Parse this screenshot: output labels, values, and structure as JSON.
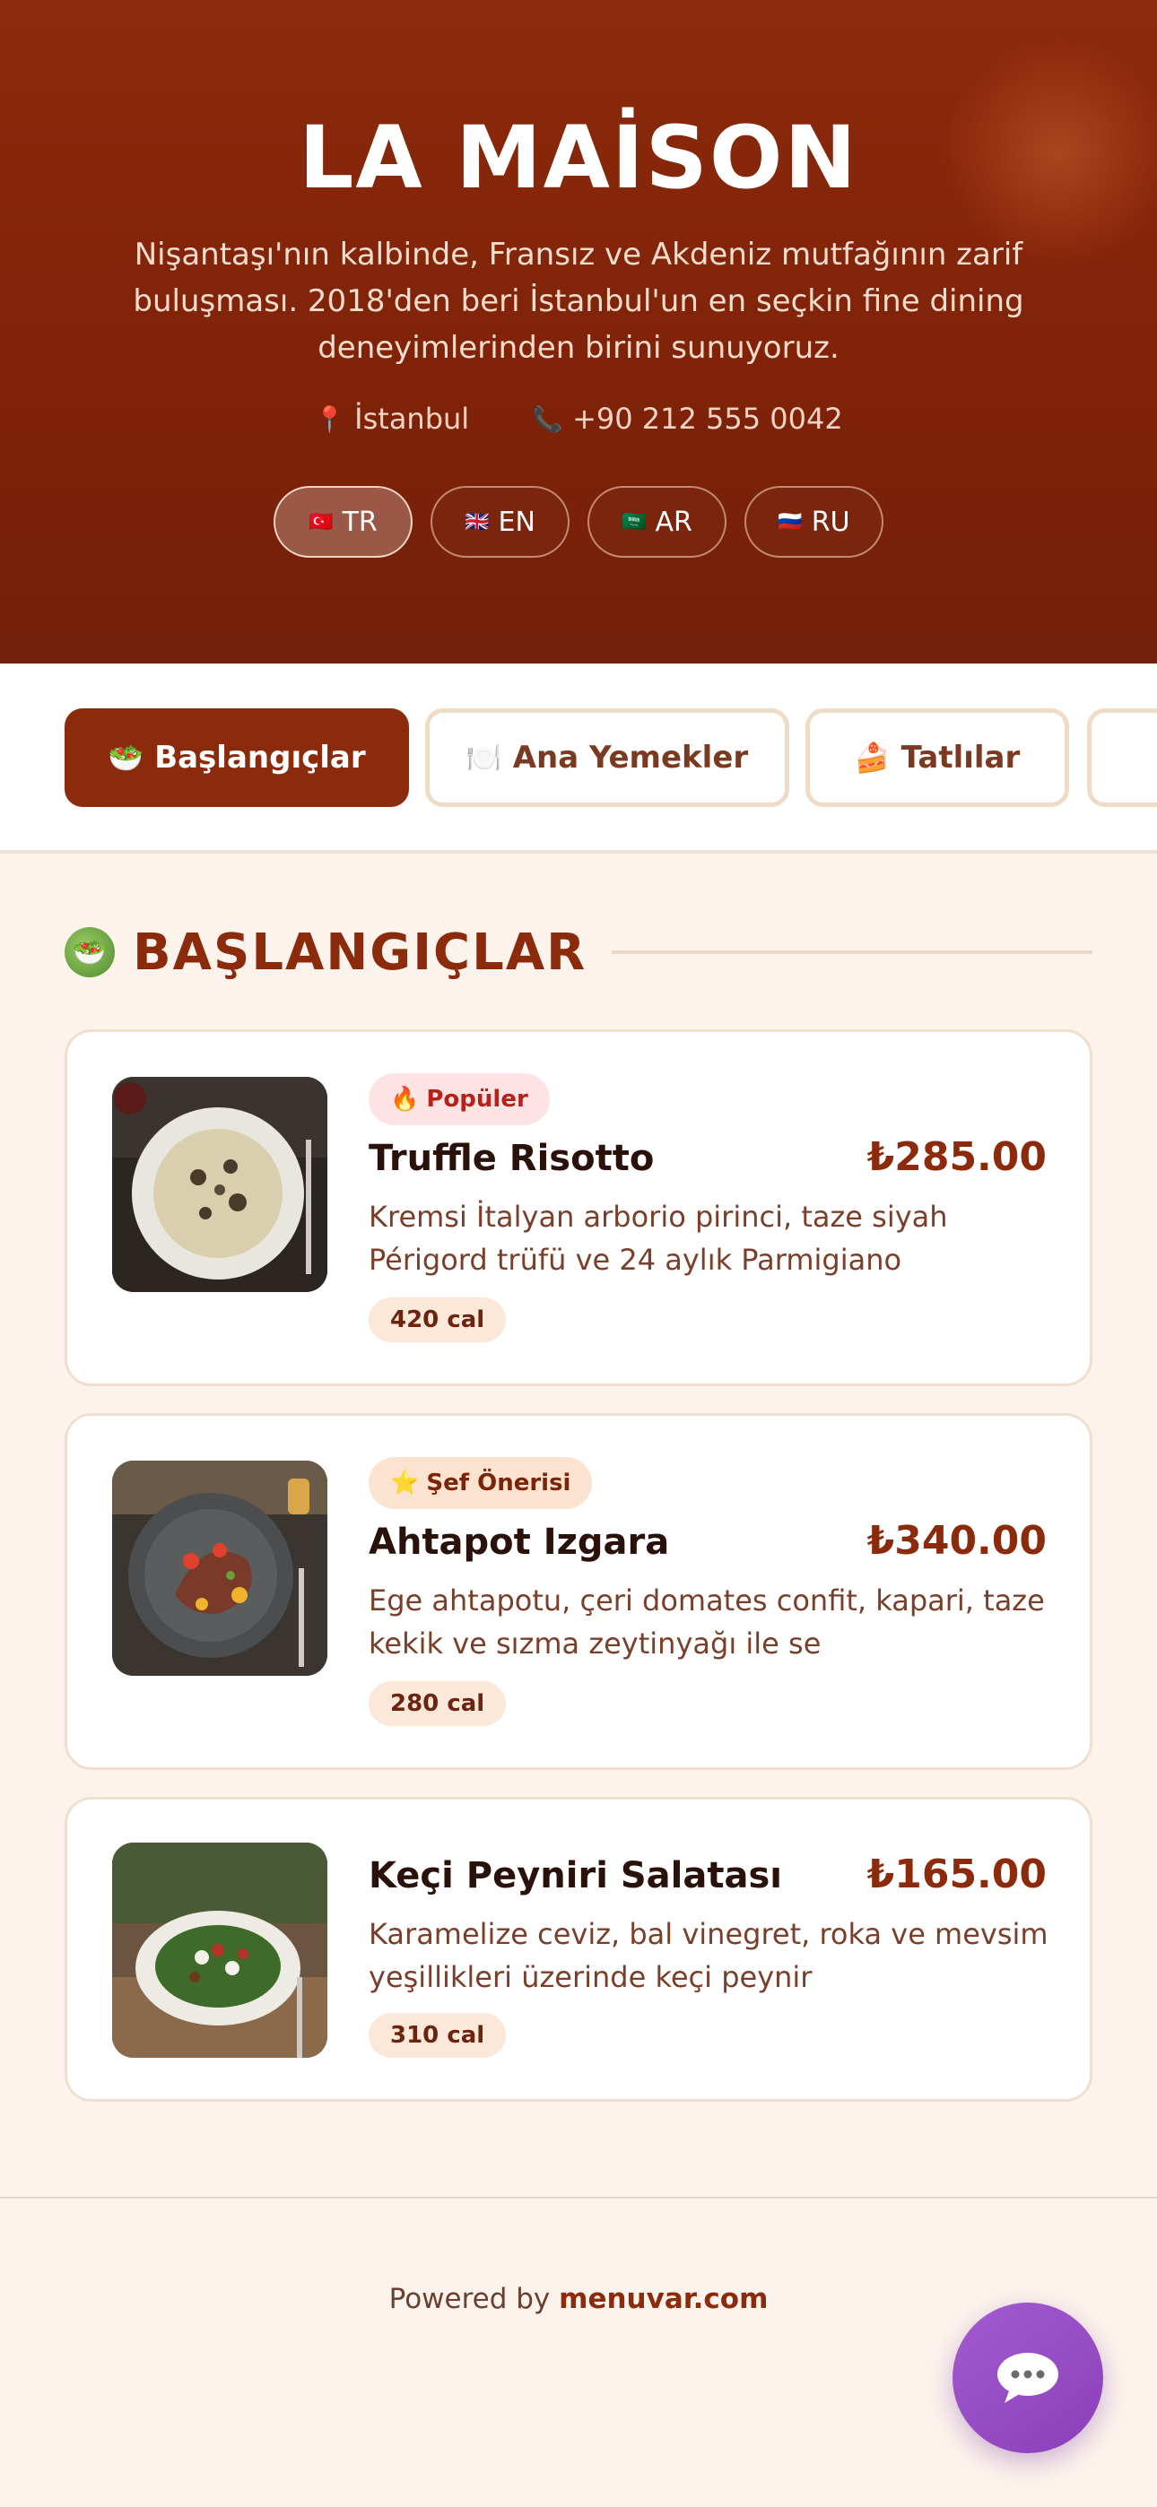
{
  "hero": {
    "title": "LA MAİSON",
    "description": "Nişantaşı'nın kalbinde, Fransız ve Akdeniz mutfağının zarif buluşması. 2018'den beri İstanbul'un en seçkin fine dining deneyimlerinden birini sunuyoruz.",
    "location": "İstanbul",
    "phone": "+90 212 555 0042",
    "location_icon": "pin-icon",
    "phone_icon": "phone-icon"
  },
  "languages": [
    {
      "code": "TR",
      "flag": "tr-flag",
      "active": true
    },
    {
      "code": "EN",
      "flag": "uk-flag",
      "active": false
    },
    {
      "code": "AR",
      "flag": "sa-flag",
      "active": false
    },
    {
      "code": "RU",
      "flag": "ru-flag",
      "active": false
    }
  ],
  "tabs": [
    {
      "label": "Başlangıçlar",
      "icon": "salad-icon",
      "active": true
    },
    {
      "label": "Ana Yemekler",
      "icon": "plate-icon",
      "active": false
    },
    {
      "label": "Tatlılar",
      "icon": "cake-icon",
      "active": false
    }
  ],
  "section": {
    "title": "BAŞLANGIÇLAR",
    "icon": "salad-icon"
  },
  "items": [
    {
      "badge": "Popüler",
      "badge_icon": "fire-icon",
      "name": "Truffle Risotto",
      "price": "₺285.00",
      "description": "Kremsi İtalyan arborio pirinci, taze siyah Périgord trüfü ve 24 aylık Parmigiano",
      "calories": "420 cal"
    },
    {
      "badge": "Şef Önerisi",
      "badge_icon": "star-icon",
      "name": "Ahtapot Izgara",
      "price": "₺340.00",
      "description": "Ege ahtapotu, çeri domates confit, kapari, taze kekik ve sızma zeytinyağı ile se",
      "calories": "280 cal"
    },
    {
      "badge": "",
      "badge_icon": "",
      "name": "Keçi Peyniri Salatası",
      "price": "₺165.00",
      "description": "Karamelize ceviz, bal vinegret, roka ve mevsim yeşillikleri üzerinde keçi peynir",
      "calories": "310 cal"
    }
  ],
  "footer": {
    "prefix": "Powered by",
    "brand": "menuvar.com"
  },
  "colors": {
    "brand": "#8c2a0c",
    "background": "#fcf4ec",
    "chat": "#9b4fc8"
  }
}
